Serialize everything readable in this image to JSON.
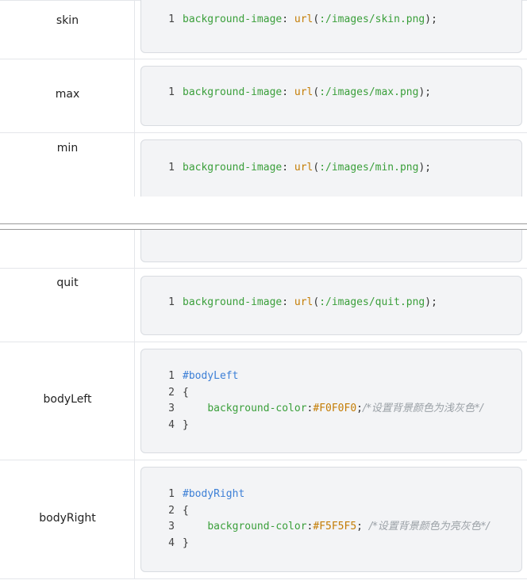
{
  "rows_top": [
    {
      "name": "skin",
      "code": {
        "prop": "background-image",
        "fn": "url",
        "arg": ":/images/skin.png"
      }
    },
    {
      "name": "max",
      "code": {
        "prop": "background-image",
        "fn": "url",
        "arg": ":/images/max.png"
      }
    },
    {
      "name": "min",
      "code": {
        "prop": "background-image",
        "fn": "url",
        "arg": ":/images/min.png"
      }
    }
  ],
  "rows_bottom": [
    {
      "name": "quit",
      "code": {
        "prop": "background-image",
        "fn": "url",
        "arg": ":/images/quit.png"
      }
    },
    {
      "name": "bodyLeft",
      "code": {
        "selector": "#bodyLeft",
        "prop": "background-color",
        "value": "#F0F0F0",
        "comment": "/*设置背景颜色为浅灰色*/"
      }
    },
    {
      "name": "bodyRight",
      "code": {
        "selector": "#bodyRight",
        "prop": "background-color",
        "value": "#F5F5F5",
        "comment": "/*设置背景颜色为亮灰色*/"
      }
    }
  ],
  "line_numbers": [
    "1",
    "2",
    "3",
    "4"
  ],
  "tokens": {
    "colon": ":",
    "open_paren": "(",
    "close_paren_semi": ");",
    "brace_open": "{",
    "brace_close": "}",
    "semi": ";",
    "semi_space": "; "
  }
}
